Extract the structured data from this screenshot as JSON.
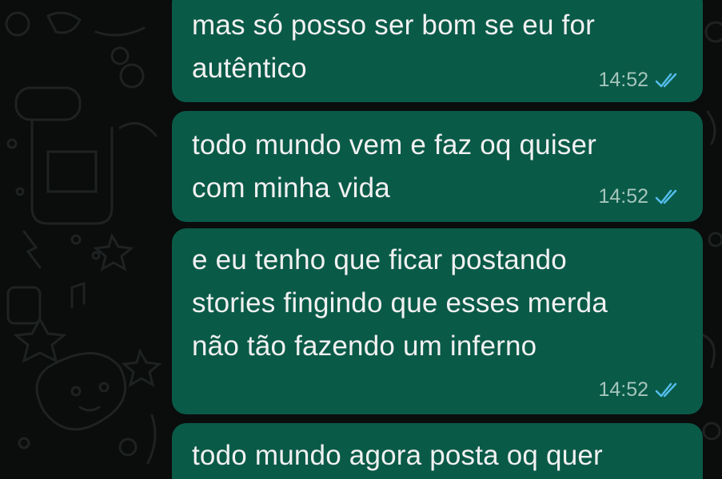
{
  "accent": {
    "bubble_color": "#0a5a48",
    "tick_color": "#53bdeb",
    "background": "#0b0c0c"
  },
  "messages": [
    {
      "lines": [
        "mas só posso ser bom se eu for",
        "autêntico"
      ],
      "time": "14:52",
      "status_icon": "double-check-read-icon"
    },
    {
      "lines": [
        "todo mundo vem e faz oq quiser",
        "com minha vida"
      ],
      "time": "14:52",
      "status_icon": "double-check-read-icon"
    },
    {
      "lines": [
        "e eu tenho que ficar postando",
        "stories fingindo que esses merda",
        "não tão fazendo um inferno"
      ],
      "time": "14:52",
      "status_icon": "double-check-read-icon"
    },
    {
      "lines": [
        "todo mundo agora posta oq quer"
      ],
      "time": "",
      "status_icon": ""
    }
  ]
}
